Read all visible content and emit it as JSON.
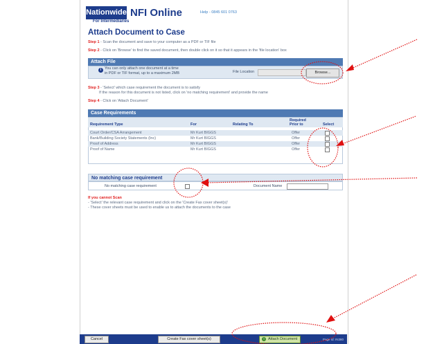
{
  "header": {
    "logo_text": "Nationwide",
    "logo_sub": "For Intermediaries",
    "brand": "NFI Online",
    "help": "Help - 0845 601 0763"
  },
  "page_title": "Attach Document to Case",
  "steps": {
    "step1_label": "Step 1",
    "step1_text": " - Scan the document and save to your computer as a PDF or TIF file",
    "step2_label": "Step 2",
    "step2_text": " - Click on 'Browse' to find the saved document, then double click on it so that it appears in the 'file location' box",
    "step3_label": "Step 3",
    "step3_text_a": " - 'Select' which case requirement the document is to satisfy",
    "step3_text_b": "If the reason for this document is not listed, click on 'no matching requirement' and provide the name",
    "step4_label": "Step 4",
    "step4_text": " - Click on 'Attach Document'"
  },
  "attach_file": {
    "heading": "Attach File",
    "info_line1": "You can only attach one document at a time",
    "info_line2": "in PDF or TIF format, up to a maximum 2MB",
    "file_location_label": "File Location",
    "browse_label": "Browse..."
  },
  "case_requirements": {
    "heading": "Case Requirements",
    "columns": {
      "type": "Requirement Type",
      "for": "For",
      "relating": "Relating To",
      "required_a": "Required",
      "required_b": "Prior to",
      "select": "Select"
    },
    "rows": [
      {
        "type": "Court Order/CSA Arrangement",
        "for": "Mr Kurt BIGGS",
        "relating": "",
        "required": "Offer"
      },
      {
        "type": "Bank/Building Society Statements (Inc)",
        "for": "Mr Kurt BIGGS",
        "relating": "",
        "required": "Offer"
      },
      {
        "type": "Proof of Address",
        "for": "Mr Kurt BIGGS",
        "relating": "",
        "required": "Offer"
      },
      {
        "type": "Proof of Name",
        "for": "Mr Kurt BIGGS",
        "relating": "",
        "required": "Offer"
      }
    ]
  },
  "no_match": {
    "heading": "No matching case requirement",
    "label": "No matching case requirement",
    "doc_name_label": "Document Name"
  },
  "cannot_scan": {
    "heading": "If you cannot Scan",
    "line1": "- 'Select' the relevant case requirement and click on the 'Create Fax cover sheet(s)'",
    "line2": "- These cover sheets must be used to enable us to attach the documents to the case"
  },
  "footer": {
    "cancel": "Cancel",
    "fax": "Create Fax cover sheet(s)",
    "attach": "Attach Document",
    "page_id": "Page Id: IN380"
  },
  "colors": {
    "brand_blue": "#1d3c8c",
    "panel_blue": "#4f7ab3",
    "step_red": "#e02020",
    "annotation_red": "#e01010"
  }
}
